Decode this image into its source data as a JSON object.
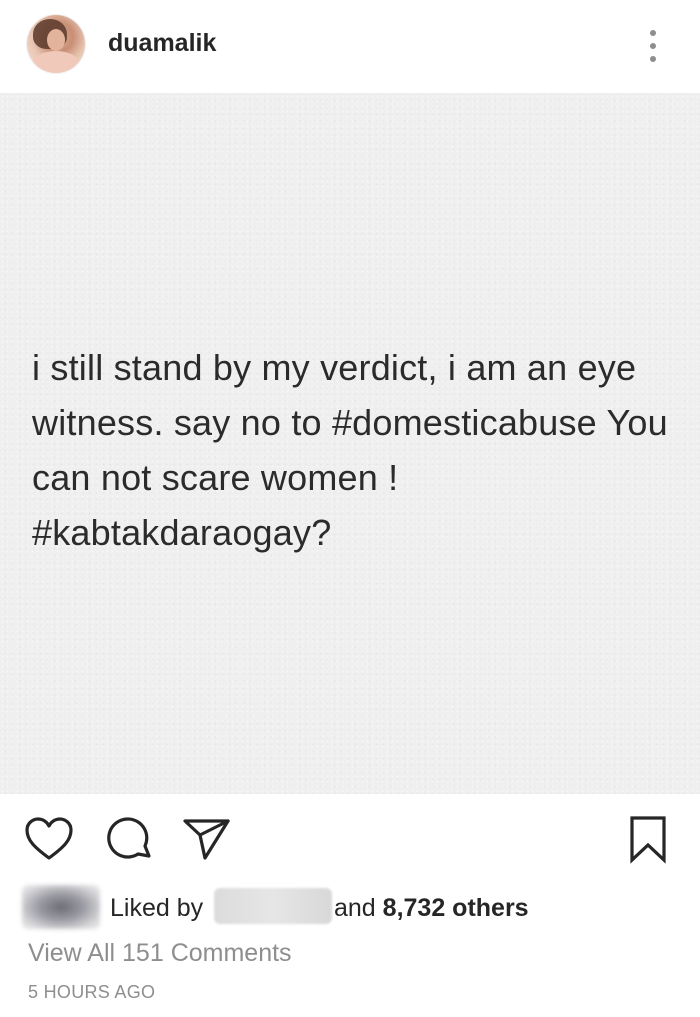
{
  "post": {
    "username": "duamalik",
    "image_text": "i still stand by my verdict, i am an eye witness. say no to #domesticabuse You can not scare women ! #kabtakdaraogay?"
  },
  "icons": {
    "more": "more-vertical-icon",
    "like": "heart-icon",
    "comment": "comment-icon",
    "share": "send-icon",
    "save": "bookmark-icon"
  },
  "engagement": {
    "liked_by_prefix": "Liked by",
    "and_label": "and",
    "others_count": "8,732 others",
    "view_comments": "View All 151 Comments",
    "timestamp": "5 HOURS AGO"
  },
  "colors": {
    "text": "#262626",
    "muted": "#8e8e8e",
    "post_background": "#efefef"
  }
}
